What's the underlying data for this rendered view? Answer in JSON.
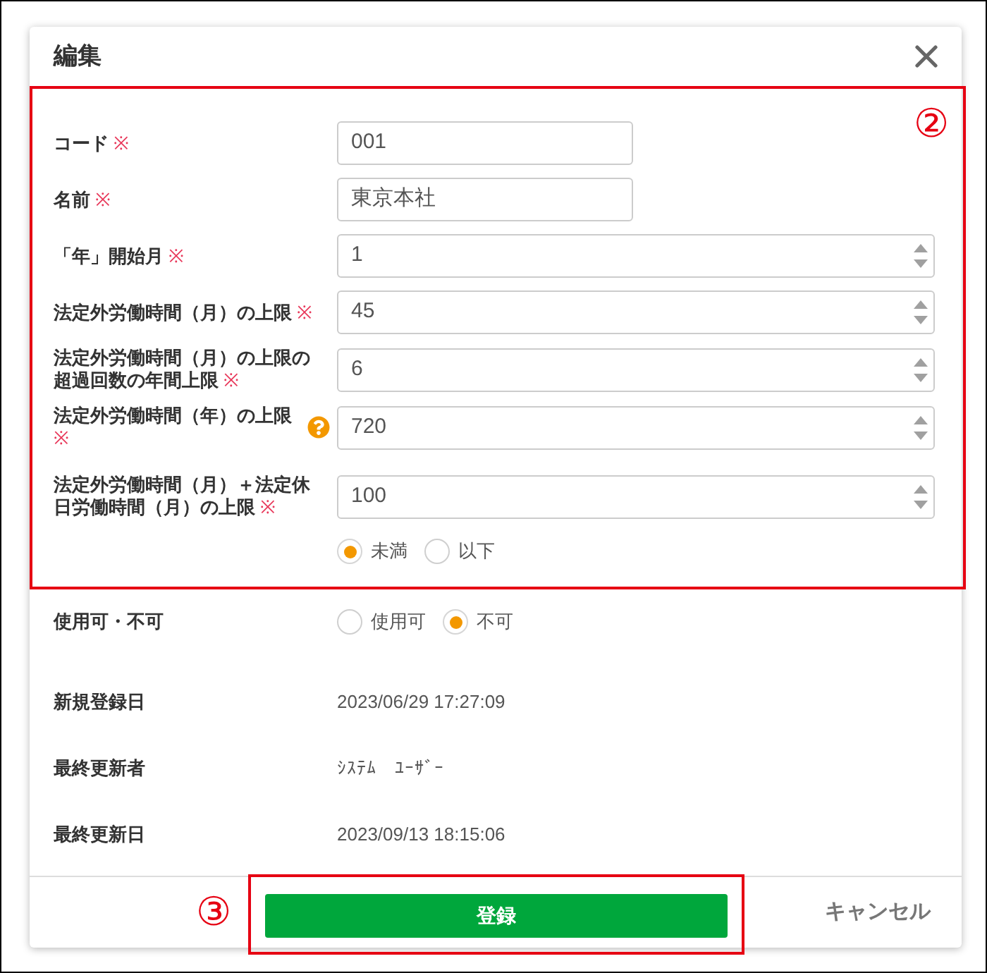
{
  "dialog": {
    "title": "編集"
  },
  "form": {
    "annotation": "②",
    "fields": [
      {
        "kind": "text",
        "label": "コード",
        "required_mark": "※",
        "value": "001"
      },
      {
        "kind": "text",
        "label": "名前",
        "required_mark": "※",
        "value": "東京本社"
      },
      {
        "kind": "number",
        "label": "「年」開始月",
        "required_mark": "※",
        "value": "1"
      },
      {
        "kind": "number",
        "label": "法定外労働時間（月）の上限",
        "required_mark": "※",
        "value": "45"
      },
      {
        "kind": "number",
        "label": "法定外労働時間（月）の上限の超過回数の年間上限",
        "required_mark": "※",
        "value": "6"
      },
      {
        "kind": "number",
        "label": "法定外労働時間（年）の上限",
        "required_mark": "※",
        "help": true,
        "value": "720"
      },
      {
        "kind": "number",
        "label": "法定外労働時間（月）＋法定休日労働時間（月）の上限",
        "required_mark": "※",
        "value": "100",
        "options": [
          {
            "label": "未満",
            "selected": true
          },
          {
            "label": "以下",
            "selected": false
          }
        ]
      }
    ]
  },
  "availability": {
    "label": "使用可・不可",
    "options": [
      {
        "label": "使用可",
        "selected": false
      },
      {
        "label": "不可",
        "selected": true
      }
    ]
  },
  "info": [
    {
      "label": "新規登録日",
      "value": "2023/06/29 17:27:09"
    },
    {
      "label": "最終更新者",
      "value": "ｼｽﾃﾑ　ﾕｰｻﾞｰ"
    },
    {
      "label": "最終更新日",
      "value": "2023/09/13 18:15:06"
    }
  ],
  "footer": {
    "annotation": "③",
    "submit": "登録",
    "cancel": "キャンセル"
  }
}
